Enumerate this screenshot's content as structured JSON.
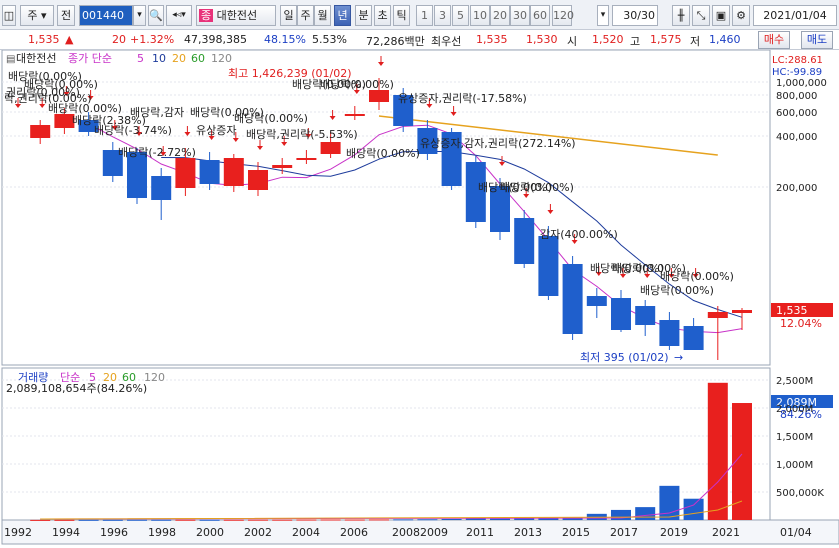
{
  "toolbar": {
    "stock_type": "주",
    "market": "전",
    "code": "001440",
    "name_badge": "종",
    "name": "대한전선",
    "periods": [
      "일",
      "주",
      "월",
      "년",
      "분",
      "초",
      "틱"
    ],
    "active_period": "년",
    "intervals": [
      "1",
      "3",
      "5",
      "10",
      "20",
      "30",
      "60",
      "120"
    ],
    "count": "30",
    "count_total": "/30",
    "date": "2021/01/04"
  },
  "quote": {
    "price": "1,535",
    "arrow": "▲",
    "change": "20",
    "change_pct": "+1.32%",
    "volume": "47,398,385",
    "turnover_pct": "48.15%",
    "ratio": "5.53%",
    "amount": "72,286백만",
    "best_label": "최우선",
    "ask": "1,535",
    "bid": "1,530",
    "open_label": "시",
    "open": "1,520",
    "high_label": "고",
    "high": "1,575",
    "low_label": "저",
    "low": "1,460",
    "buy_label": "매수",
    "sell_label": "매도"
  },
  "price_panel": {
    "name": "대한전선",
    "ma_label": "종가 단순",
    "ma_periods": [
      "5",
      "10",
      "20",
      "60",
      "120"
    ],
    "lc_label": "LC:288.61",
    "hc_label": "HC:-99.89",
    "high_note": "최고 1,426,239 (01/02)",
    "low_note": "최저 395 (01/02)",
    "current_price": "1,535",
    "current_pct": "12.04%",
    "y_ticks": [
      "1,000,000",
      "800,000",
      "600,000",
      "400,000",
      "200,000"
    ]
  },
  "volume_panel": {
    "label": "거래량",
    "ma_label": "단순",
    "ma_periods": [
      "5",
      "20",
      "60",
      "120"
    ],
    "value_text": "2,089,108,654주(84.26%)",
    "current": "2,089M",
    "current_pct": "84.26%",
    "y_ticks": [
      "2,500M",
      "2,000M",
      "1,500M",
      "1,000M",
      "500,000K"
    ]
  },
  "x_axis": {
    "labels": [
      "1992",
      "1994",
      "1996",
      "1998",
      "2000",
      "2002",
      "2004",
      "2006",
      "2008",
      "2009",
      "2011",
      "2013",
      "2015",
      "2017",
      "2019",
      "2021"
    ],
    "right_label": "01/04"
  },
  "annotations": [
    "배당락(0.00%)",
    "배당락(0.00%)",
    "권리락(0.00%)",
    "락,권리락(0.00%)",
    "배당락(0.00%)",
    "배당락(2.38%)",
    "배당락(-3.74%)",
    "배당락,감자",
    "배당락(0.00%)",
    "배당락(-2.72%)",
    "유상증자",
    "배당락(0.00%)",
    "배당락,권리락(-5.53%)",
    "배당락(0.00%)",
    "배당락(0.00%)",
    "배당락(0.00%)",
    "유상증자,권리락(-17.58%)",
    "배당락(0.00%)",
    "유상증자,감자,권리락(272.14%)",
    "배당락(0.00%)",
    "감자(400.00%)",
    "배당락(0.00%)",
    "배당락(0.00%)",
    "배당락(0.00%)",
    "배당락(0.00%)"
  ],
  "chart_data": {
    "type": "candlestick",
    "x": [
      "1991",
      "1992",
      "1993",
      "1994",
      "1995",
      "1996",
      "1997",
      "1998",
      "1999",
      "2000",
      "2001",
      "2002",
      "2003",
      "2004",
      "2005",
      "2006",
      "2007",
      "2008",
      "2009",
      "2010",
      "2011",
      "2012",
      "2013",
      "2014",
      "2015",
      "2016",
      "2017",
      "2018",
      "2019",
      "2020",
      "2021"
    ],
    "direction": [
      "up",
      "up",
      "up",
      "down",
      "down",
      "down",
      "down",
      "up",
      "down",
      "up",
      "up",
      "up",
      "up",
      "up",
      "up",
      "up",
      "down",
      "down",
      "down",
      "down",
      "down",
      "down",
      "down",
      "down",
      "down",
      "down",
      "down",
      "down",
      "down",
      "up",
      "up"
    ],
    "volume_values_M": [
      2,
      2,
      3,
      3,
      3,
      4,
      4,
      5,
      4,
      5,
      6,
      6,
      8,
      9,
      8,
      10,
      12,
      14,
      18,
      30,
      24,
      28,
      35,
      40,
      110,
      180,
      230,
      610,
      380,
      2450,
      2089
    ],
    "price_scale": "log",
    "colors": {
      "up": "#e8201e",
      "down": "#1f5fcc",
      "ma5": "#c832c8",
      "ma10": "#1e3c9c",
      "ma20": "#e6a21e"
    }
  }
}
